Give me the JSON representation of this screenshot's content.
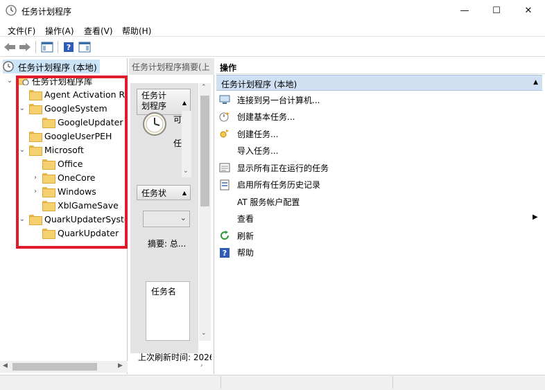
{
  "window": {
    "title": "任务计划程序",
    "minimize_glyph": "—",
    "maximize_glyph": "☐",
    "close_glyph": "✕"
  },
  "menu": {
    "file": "文件(F)",
    "action": "操作(A)",
    "view": "查看(V)",
    "help": "帮助(H)"
  },
  "tree": {
    "root": "任务计划程序 (本地)",
    "library": "任务计划程序库",
    "items": [
      {
        "label": "Agent Activation Run",
        "depth": 1,
        "expander": ""
      },
      {
        "label": "GoogleSystem",
        "depth": 1,
        "expander": "⌄"
      },
      {
        "label": "GoogleUpdater",
        "depth": 2,
        "expander": ""
      },
      {
        "label": "GoogleUserPEH",
        "depth": 1,
        "expander": ""
      },
      {
        "label": "Microsoft",
        "depth": 1,
        "expander": "⌄"
      },
      {
        "label": "Office",
        "depth": 2,
        "expander": ""
      },
      {
        "label": "OneCore",
        "depth": 2,
        "expander": "›"
      },
      {
        "label": "Windows",
        "depth": 2,
        "expander": "›"
      },
      {
        "label": "XblGameSave",
        "depth": 2,
        "expander": ""
      },
      {
        "label": "QuarkUpdaterSystem",
        "depth": 1,
        "expander": "⌄"
      },
      {
        "label": "QuarkUpdater",
        "depth": 2,
        "expander": ""
      }
    ]
  },
  "middle": {
    "header": "任务计划程序摘要(上",
    "section1_btn": "任务计",
    "section1_btn_line2": "划程序",
    "clock_text1": "可",
    "clock_text2": "任",
    "section2_btn": "任务状",
    "summary": "摘要: 总...",
    "list_header": "任务名",
    "last_refresh": "上次刷新时间: 2026"
  },
  "actions": {
    "header": "操作",
    "section": "任务计划程序 (本地)",
    "items": [
      {
        "label": "连接到另一台计算机...",
        "icon": "computer-icon"
      },
      {
        "label": "创建基本任务...",
        "icon": "basic-task-icon"
      },
      {
        "label": "创建任务...",
        "icon": "create-task-icon"
      },
      {
        "label": "导入任务...",
        "icon": ""
      },
      {
        "label": "显示所有正在运行的任务",
        "icon": "running-tasks-icon"
      },
      {
        "label": "启用所有任务历史记录",
        "icon": "history-icon"
      },
      {
        "label": "AT 服务帐户配置",
        "icon": ""
      },
      {
        "label": "查看",
        "icon": ""
      },
      {
        "label": "刷新",
        "icon": "refresh-icon"
      },
      {
        "label": "帮助",
        "icon": "help-icon"
      }
    ]
  },
  "colors": {
    "highlight_box": "#e01c2b",
    "section_bg": "#cfe0f2"
  }
}
